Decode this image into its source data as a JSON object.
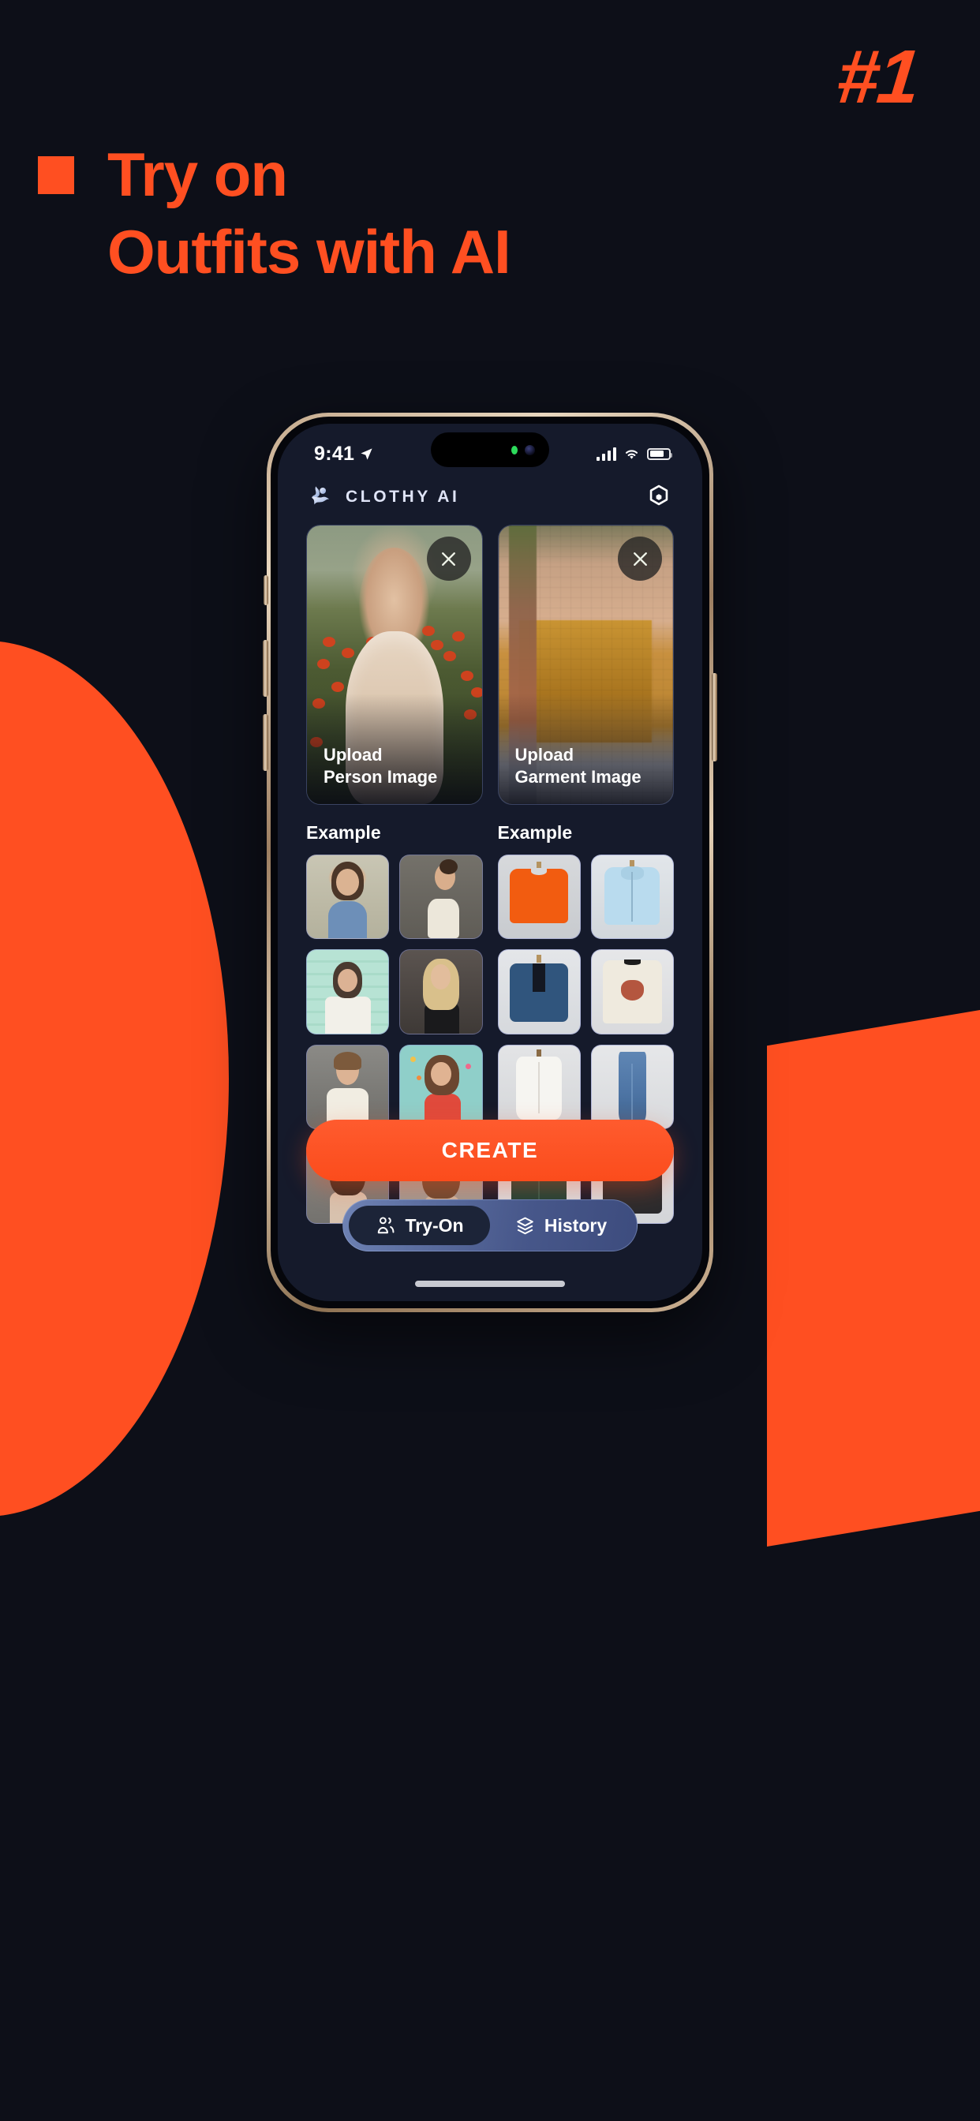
{
  "promo": {
    "rank_badge": "#1",
    "headline_line1": "Try on",
    "headline_line2": "Outfits with AI",
    "accent_color": "#ff4f21",
    "background_color": "#0d0f18"
  },
  "status_bar": {
    "time": "9:41",
    "location_icon": "location-arrow-icon",
    "signal_icon": "cellular-signal-icon",
    "wifi_icon": "wifi-icon",
    "battery_icon": "battery-icon"
  },
  "app": {
    "brand_name": "CLOTHY AI",
    "logo_icon": "clothy-figure-logo",
    "settings_icon": "gear-icon"
  },
  "upload_cards": [
    {
      "label_line1": "Upload",
      "label_line2": "Person Image",
      "close_icon": "close-icon",
      "name": "person"
    },
    {
      "label_line1": "Upload",
      "label_line2": "Garment Image",
      "close_icon": "close-icon",
      "name": "garment"
    }
  ],
  "examples": {
    "person": {
      "title": "Example",
      "thumbs": [
        "woman-blue-vneck-dress",
        "woman-cream-cami-bun",
        "woman-white-shirt-teal-wall",
        "woman-blonde-black-tank",
        "woman-white-turtleneck",
        "woman-red-top-confetti",
        "woman-beige-strap-top",
        "woman-long-hair-portrait"
      ]
    },
    "garment": {
      "title": "Example",
      "thumbs": [
        "orange-sweatshirt",
        "light-blue-hoodie",
        "blue-leather-jacket",
        "cream-moth-graphic-tee",
        "white-button-shirt",
        "blue-jeans",
        "dark-green-bomber-jacket",
        "black-vneck-tee"
      ]
    }
  },
  "create_button": {
    "label": "CREATE"
  },
  "tabbar": {
    "tabs": [
      {
        "label": "Try-On",
        "icon": "person-group-icon",
        "active": true
      },
      {
        "label": "History",
        "icon": "layers-stack-icon",
        "active": false
      }
    ]
  }
}
